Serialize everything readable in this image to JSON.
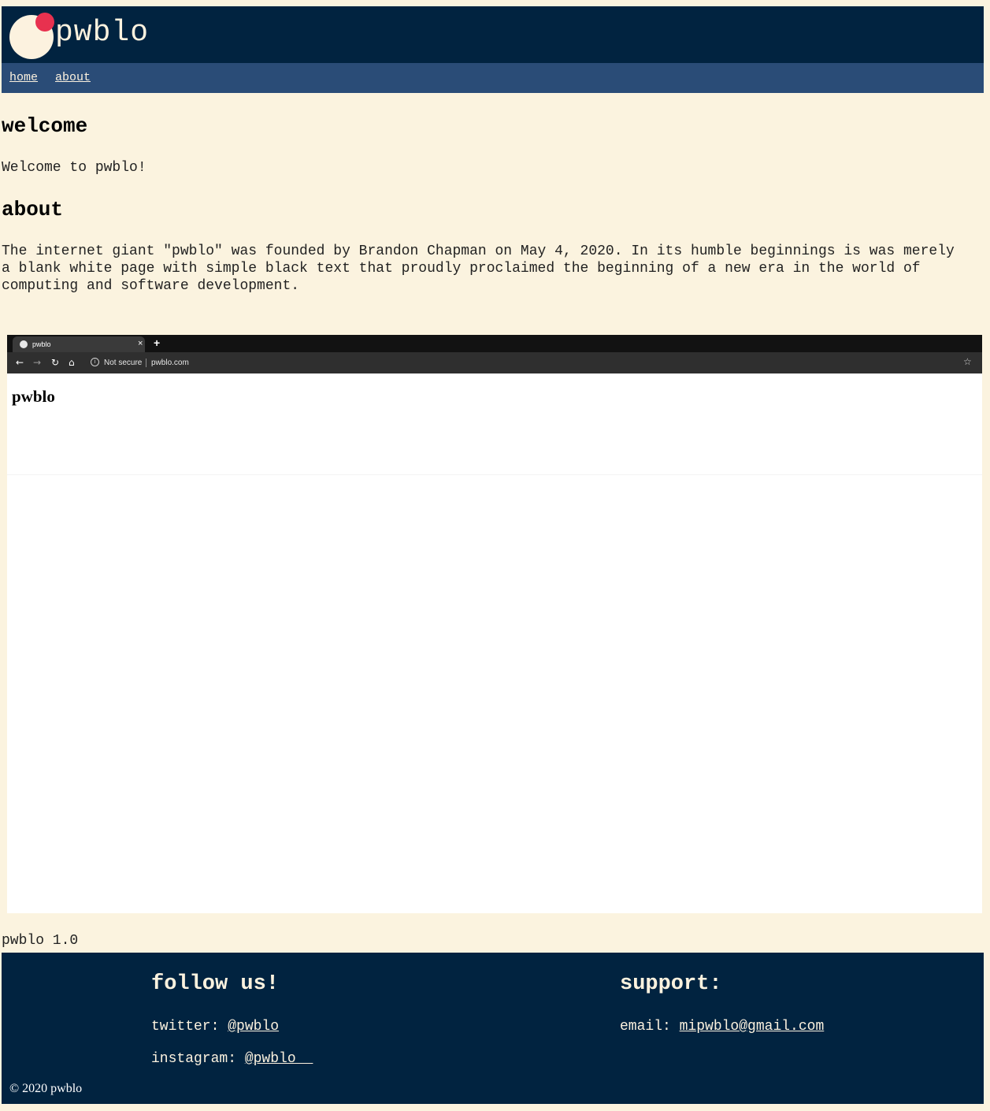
{
  "header": {
    "site_title": "pwblo",
    "logo_icon": "pwblo-logo-icon"
  },
  "nav": {
    "items": [
      {
        "label": "home"
      },
      {
        "label": "about"
      }
    ]
  },
  "main": {
    "welcome_heading": "welcome",
    "welcome_text": "Welcome to pwblo!",
    "about_heading": "about",
    "about_text": "The internet giant \"pwblo\" was founded by Brandon Chapman on May 4, 2020. In its humble beginnings is was merely a blank white page with simple black text that proudly proclaimed the beginning of a new era in the world of computing and software development."
  },
  "screenshot": {
    "tab_title": "pwblo",
    "tab_close": "×",
    "new_tab": "+",
    "security_label": "Not secure",
    "url": "pwblo.com",
    "page_heading": "pwblo",
    "icons": [
      "globe-icon",
      "back-icon",
      "forward-icon",
      "reload-icon",
      "home-icon",
      "info-icon",
      "star-icon"
    ]
  },
  "version": "pwblo 1.0",
  "footer": {
    "follow_heading": "follow us!",
    "twitter_label": "twitter: ",
    "twitter_handle": "@pwblo",
    "instagram_label": "instagram: ",
    "instagram_handle": "@pwblo__",
    "support_heading": "support:",
    "email_label": "email: ",
    "email_address": "mipwblo@gmail.com",
    "copyright": "© 2020 pwblo"
  },
  "colors": {
    "background": "#fbf3df",
    "header": "#012340",
    "nav": "#2a4c77",
    "logo_accent": "#e8314f",
    "text_light": "#fcf2df"
  }
}
